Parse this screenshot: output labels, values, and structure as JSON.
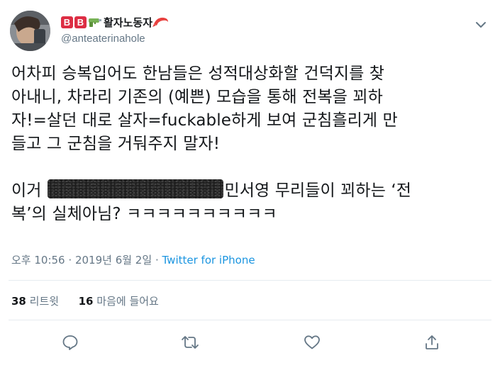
{
  "author": {
    "display_name": "활자노동자",
    "badge_letters": [
      "B",
      "B"
    ],
    "handle": "@anteaterinahole",
    "avatar_icon": "avatar-photo-icon",
    "name_emojis": [
      "water-pistol-icon",
      "shrimp-icon"
    ]
  },
  "tweet": {
    "lines": [
      "어차피 승복입어도 한남들은 성적대상화할 건덕지를 찾",
      "아내니, 차라리 기존의 (예쁜) 모습을 통해 전복을 꾀하",
      "자!=살던 대로 살자=fuckable하게 보여 군침흘리게 만",
      "들고 그 군침을 거둬주지 말자!"
    ],
    "line5_prefix": "이거",
    "line5_suffix": "민서영 무리들이 꾀하는 ‘전",
    "line6": "복’의 실체아님? ㅋㅋㅋㅋㅋㅋㅋㅋㅋㅋ"
  },
  "meta": {
    "time": "오후 10:56",
    "separator": "·",
    "date": "2019년 6월 2일",
    "source": "Twitter for iPhone"
  },
  "stats": {
    "retweet_count": "38",
    "retweet_label": "리트윗",
    "like_count": "16",
    "like_label": "마음에 들어요"
  },
  "actions": [
    "reply-icon",
    "retweet-icon",
    "like-icon",
    "share-icon"
  ],
  "colors": {
    "badge_red": "#dd2e44",
    "link_blue": "#1b95e0",
    "muted_gray": "#657786",
    "divider": "#e6ecf0"
  }
}
